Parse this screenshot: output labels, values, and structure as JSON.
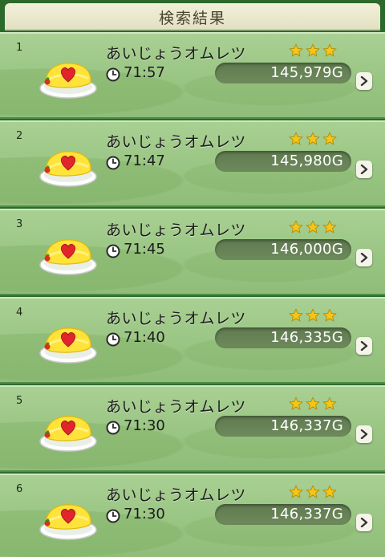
{
  "header": {
    "title": "検索結果"
  },
  "results": [
    {
      "index": "1",
      "name": "あいじょうオムレツ",
      "time": "71:57",
      "price": "145,979G",
      "stars": 3
    },
    {
      "index": "2",
      "name": "あいじょうオムレツ",
      "time": "71:47",
      "price": "145,980G",
      "stars": 3
    },
    {
      "index": "3",
      "name": "あいじょうオムレツ",
      "time": "71:45",
      "price": "146,000G",
      "stars": 3
    },
    {
      "index": "4",
      "name": "あいじょうオムレツ",
      "time": "71:40",
      "price": "146,335G",
      "stars": 3
    },
    {
      "index": "5",
      "name": "あいじょうオムレツ",
      "time": "71:30",
      "price": "146,337G",
      "stars": 3
    },
    {
      "index": "6",
      "name": "あいじょうオムレツ",
      "time": "71:30",
      "price": "146,337G",
      "stars": 3
    }
  ],
  "icons": {
    "item": "omelette-heart-icon",
    "time": "clock-icon",
    "rating": "star-icon",
    "open": "chevron-right-icon"
  },
  "colors": {
    "star": "#f5c518",
    "heart": "#e0262c",
    "omelette": "#ffe33a",
    "price_box": "#647f54"
  }
}
